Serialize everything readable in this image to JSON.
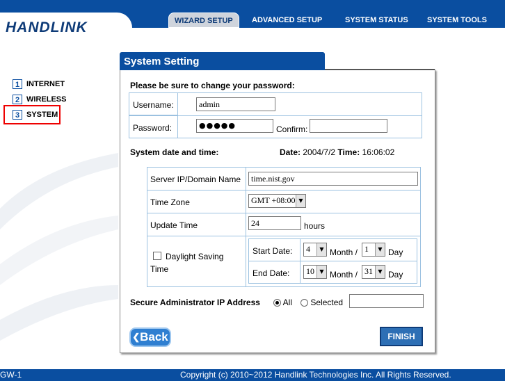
{
  "header": {
    "logo": "HANDLINK",
    "tabs": [
      {
        "label": "WIZARD SETUP"
      },
      {
        "label": "ADVANCED SETUP"
      },
      {
        "label": "SYSTEM STATUS"
      },
      {
        "label": "SYSTEM TOOLS"
      }
    ]
  },
  "sidebar": {
    "items": [
      {
        "num": "1",
        "label": "INTERNET"
      },
      {
        "num": "2",
        "label": "WIRELESS"
      },
      {
        "num": "3",
        "label": "SYSTEM"
      }
    ]
  },
  "panel": {
    "title": "System Setting",
    "password_heading": "Please be sure to change your password:",
    "username_label": "Username:",
    "username_value": "admin",
    "password_label": "Password:",
    "password_value": "●●●●●",
    "confirm_label": "Confirm:",
    "confirm_value": "",
    "datetime_heading": "System date and time:",
    "date_label": "Date:",
    "date_value": "2004/7/2",
    "time_label": "Time:",
    "time_value": "16:06:02",
    "server_label": "Server IP/Domain Name",
    "server_value": "time.nist.gov",
    "timezone_label": "Time Zone",
    "timezone_value": "GMT +08:00",
    "update_label": "Update Time",
    "update_value": "24",
    "update_unit": "hours",
    "dst_label_1": "Daylight Saving",
    "dst_label_2": "Time",
    "dst_checked": false,
    "start_date_label": "Start Date:",
    "start_month": "4",
    "start_day": "1",
    "end_date_label": "End Date:",
    "end_month": "10",
    "end_day": "31",
    "month_label": "Month /",
    "day_label": "Day",
    "secure_label": "Secure Administrator IP Address",
    "opt_all": "All",
    "opt_selected": "Selected",
    "secure_ip_value": "",
    "back_label": "Back",
    "finish_label": "FINISH"
  },
  "footer": {
    "left": "GW-1",
    "copyright": "Copyright (c) 2010~2012 Handlink Technologies Inc. All Rights Reserved."
  },
  "colors": {
    "brand_blue": "#0a4ea0",
    "logo": "#0e3b78",
    "highlight_red": "#e00000"
  },
  "icons": [
    "chevron-left-icon",
    "dropdown-arrow-icon",
    "radio-icon",
    "checkbox-icon"
  ]
}
